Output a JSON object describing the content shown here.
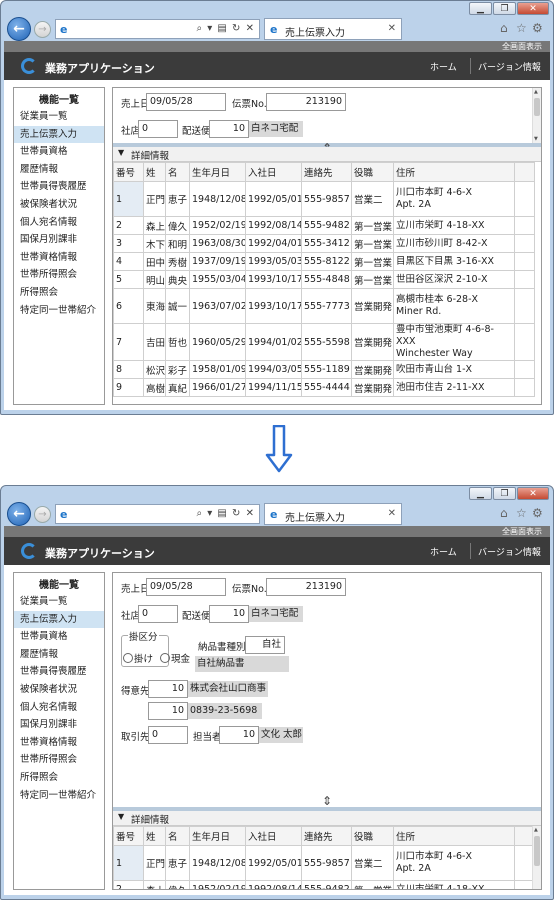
{
  "browser": {
    "tab_title": "売上伝票入力",
    "fullscreen_label": "全画面表示"
  },
  "app": {
    "title": "業務アプリケーション",
    "nav_home": "ホーム",
    "nav_version": "バージョン情報"
  },
  "sidebar": {
    "title": "機能一覧",
    "items": [
      "従業員一覧",
      "売上伝票入力",
      "世帯員資格",
      "履歴情報",
      "世帯員得喪履歴",
      "被保険者状況",
      "個人宛名情報",
      "国保月別課非",
      "世帯資格情報",
      "世帯所得照会",
      "所得照会",
      "特定同一世帯紹介"
    ],
    "selected": "売上伝票入力"
  },
  "form": {
    "sales_date_label": "売上日",
    "sales_date_value": "09/05/28",
    "slip_no_label": "伝票No.",
    "slip_no_value": "213190",
    "store_label": "社店",
    "store_value": "0",
    "delivery_label": "配送便",
    "delivery_code": "10",
    "delivery_name": "白ネコ宅配",
    "payment_group_label": "掛区分",
    "payment_credit": "掛け",
    "payment_cash": "現金",
    "invoice_type_label": "納品書種別",
    "invoice_type_code": "自社",
    "invoice_type_name": "自社納品書",
    "customer_label": "得意先",
    "customer_code": "10",
    "customer_name": "株式会社山口商事",
    "customer_phone_code": "10",
    "customer_phone": "0839-23-5698",
    "trade_label": "取引先",
    "trade_value": "0",
    "staff_label": "担当者",
    "staff_code": "10",
    "staff_name": "文化 太郎"
  },
  "detail": {
    "label": "詳細情報",
    "columns": [
      "番号",
      "姓",
      "名",
      "生年月日",
      "入社日",
      "連絡先",
      "役職",
      "住所"
    ],
    "rows": [
      {
        "no": "1",
        "last": "正門",
        "first": "恵子",
        "birth": "1948/12/08",
        "hire": "1992/05/01",
        "phone": "555-9857",
        "role": "営業二",
        "addr1": "川口市本町 4-6-X",
        "addr2": "Apt. 2A"
      },
      {
        "no": "2",
        "last": "森上",
        "first": "偉久",
        "birth": "1952/02/19",
        "hire": "1992/08/14",
        "phone": "555-9482",
        "role": "第一営業",
        "addr1": "立川市栄町 4-18-XX",
        "addr2": ""
      },
      {
        "no": "3",
        "last": "木下",
        "first": "和明",
        "birth": "1963/08/30",
        "hire": "1992/04/01",
        "phone": "555-3412",
        "role": "第一営業",
        "addr1": "立川市砂川町 8-42-X",
        "addr2": ""
      },
      {
        "no": "4",
        "last": "田中",
        "first": "秀樹",
        "birth": "1937/09/19",
        "hire": "1993/05/03",
        "phone": "555-8122",
        "role": "第一営業",
        "addr1": "目黒区下目黒 3-16-XX",
        "addr2": ""
      },
      {
        "no": "5",
        "last": "明山",
        "first": "典央",
        "birth": "1955/03/04",
        "hire": "1993/10/17",
        "phone": "555-4848",
        "role": "第一営業",
        "addr1": "世田谷区深沢 2-10-X",
        "addr2": ""
      },
      {
        "no": "6",
        "last": "東海",
        "first": "誠一",
        "birth": "1963/07/02",
        "hire": "1993/10/17",
        "phone": "555-7773",
        "role": "営業開発",
        "addr1": "高槻市桂本 6-28-X",
        "addr2": "Miner Rd."
      },
      {
        "no": "7",
        "last": "吉田",
        "first": "哲也",
        "birth": "1960/05/29",
        "hire": "1994/01/02",
        "phone": "555-5598",
        "role": "営業開発",
        "addr1": "豊中市蛍池東町 4-6-8-XXX",
        "addr2": "Winchester Way"
      },
      {
        "no": "8",
        "last": "松沢",
        "first": "彩子",
        "birth": "1958/01/09",
        "hire": "1994/03/05",
        "phone": "555-1189",
        "role": "営業開発",
        "addr1": "吹田市青山台 1-X",
        "addr2": ""
      },
      {
        "no": "9",
        "last": "高樹",
        "first": "真紀",
        "birth": "1966/01/27",
        "hire": "1994/11/15",
        "phone": "555-4444",
        "role": "営業開発",
        "addr1": "池田市住吉 2-11-XX",
        "addr2": ""
      }
    ]
  },
  "colors": {
    "accent": "#1f63b6",
    "header": "#3b3b3b",
    "selected": "#cfe3f3",
    "arrow": "#2e6fd1"
  }
}
